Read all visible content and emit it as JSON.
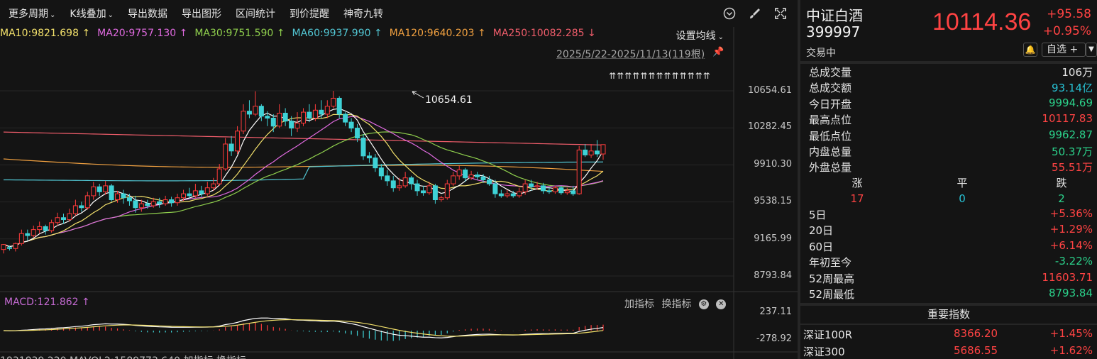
{
  "toolbar": {
    "items": [
      "更多周期",
      "K线叠加",
      "导出数据",
      "导出图形",
      "区间统计",
      "到价提醒",
      "神奇九转"
    ]
  },
  "ma": [
    {
      "label": "MA10:9821.698",
      "arrow": "↑",
      "color": "#f2e06b"
    },
    {
      "label": "MA20:9757.130",
      "arrow": "↑",
      "color": "#e06ae0"
    },
    {
      "label": "MA30:9751.590",
      "arrow": "↑",
      "color": "#8fcf4d"
    },
    {
      "label": "MA60:9937.990",
      "arrow": "↑",
      "color": "#52c7d4"
    },
    {
      "label": "MA120:9640.203",
      "arrow": "↑",
      "color": "#f0a040"
    },
    {
      "label": "MA250:10082.285",
      "arrow": "↓",
      "color": "#f05d6b"
    }
  ],
  "ma_setting": "设置均线",
  "range_label": "2025/5/22-2025/11/13(119根)",
  "marker_arrows": "⇈⇈⇈⇈⇈⇈⇈⇈⇈⇈⇈⇈⇈",
  "peak_label": "10654.61",
  "price_axis": [
    "10654.61",
    "10282.45",
    "9910.30",
    "9538.15",
    "9165.99",
    "8793.84"
  ],
  "macd": {
    "title": "MACD:121.862",
    "arrow": "↑",
    "add_indicator": "加指标",
    "switch_indicator": "换指标",
    "axis": [
      "237.11",
      "-278.92"
    ]
  },
  "bottom_cut": "1831839.220   MAVOL2:1589773.640   加指标 换指标",
  "quote": {
    "name": "中证白酒",
    "code": "399997",
    "status": "交易中",
    "price": "10114.36",
    "change": "+95.58",
    "pct": "+0.95%",
    "watch": "自选 +"
  },
  "stats": [
    {
      "label": "总成交量",
      "value": "106万",
      "color": "white"
    },
    {
      "label": "总成交额",
      "value": "93.14亿",
      "color": "cyan"
    },
    {
      "label": "今日开盘",
      "value": "9994.69",
      "color": "green"
    },
    {
      "label": "最高点位",
      "value": "10117.83",
      "color": "red"
    },
    {
      "label": "最低点位",
      "value": "9962.87",
      "color": "green"
    },
    {
      "label": "内盘总量",
      "value": "50.37万",
      "color": "green"
    },
    {
      "label": "外盘总量",
      "value": "55.51万",
      "color": "red"
    }
  ],
  "updown": {
    "up_label": "涨",
    "flat_label": "平",
    "down_label": "跌",
    "up": "17",
    "flat": "0",
    "down": "2"
  },
  "periods": [
    {
      "label": "5日",
      "value": "+5.36%",
      "color": "red"
    },
    {
      "label": "20日",
      "value": "+1.29%",
      "color": "red"
    },
    {
      "label": "60日",
      "value": "+6.14%",
      "color": "red"
    },
    {
      "label": "年初至今",
      "value": "-3.22%",
      "color": "green"
    },
    {
      "label": "52周最高",
      "value": "11603.71",
      "color": "red"
    },
    {
      "label": "52周最低",
      "value": "8793.84",
      "color": "green"
    }
  ],
  "index_title": "重要指数",
  "indices": [
    {
      "name": "深证100R",
      "price": "8366.20",
      "chg": "+1.45%"
    },
    {
      "name": "深证300",
      "price": "5686.55",
      "chg": "+1.62%"
    }
  ],
  "chart_data": {
    "type": "candlestick",
    "y_range": [
      8793.84,
      10654.61
    ],
    "colors": {
      "up": "#ff3b3b",
      "down": "#3ed2d6"
    },
    "candles": [
      [
        9060,
        9110,
        9020,
        9080
      ],
      [
        9080,
        9070,
        9050,
        9100
      ],
      [
        9070,
        9120,
        9040,
        9130
      ],
      [
        9120,
        9220,
        9100,
        9260
      ],
      [
        9220,
        9200,
        9150,
        9260
      ],
      [
        9200,
        9260,
        9180,
        9300
      ],
      [
        9260,
        9290,
        9220,
        9340
      ],
      [
        9290,
        9250,
        9210,
        9310
      ],
      [
        9250,
        9330,
        9230,
        9360
      ],
      [
        9330,
        9380,
        9300,
        9430
      ],
      [
        9380,
        9360,
        9320,
        9420
      ],
      [
        9360,
        9420,
        9340,
        9470
      ],
      [
        9420,
        9500,
        9400,
        9560
      ],
      [
        9500,
        9480,
        9440,
        9540
      ],
      [
        9480,
        9600,
        9460,
        9640
      ],
      [
        9600,
        9690,
        9560,
        9740
      ],
      [
        9690,
        9640,
        9600,
        9720
      ],
      [
        9640,
        9700,
        9610,
        9750
      ],
      [
        9700,
        9560,
        9540,
        9720
      ],
      [
        9560,
        9620,
        9530,
        9650
      ],
      [
        9620,
        9580,
        9520,
        9660
      ],
      [
        9580,
        9550,
        9500,
        9620
      ],
      [
        9550,
        9480,
        9430,
        9600
      ],
      [
        9480,
        9520,
        9440,
        9560
      ],
      [
        9520,
        9500,
        9470,
        9560
      ],
      [
        9500,
        9540,
        9480,
        9580
      ],
      [
        9540,
        9520,
        9480,
        9580
      ],
      [
        9520,
        9560,
        9500,
        9600
      ],
      [
        9560,
        9530,
        9490,
        9590
      ],
      [
        9530,
        9580,
        9500,
        9620
      ],
      [
        9580,
        9620,
        9550,
        9660
      ],
      [
        9620,
        9600,
        9570,
        9680
      ],
      [
        9600,
        9650,
        9580,
        9720
      ],
      [
        9650,
        9620,
        9590,
        9700
      ],
      [
        9620,
        9680,
        9600,
        9740
      ],
      [
        9680,
        9720,
        9650,
        9780
      ],
      [
        9720,
        9870,
        9700,
        9920
      ],
      [
        9870,
        10120,
        9850,
        10180
      ],
      [
        10120,
        10050,
        10000,
        10200
      ],
      [
        10050,
        10250,
        10020,
        10300
      ],
      [
        10250,
        10450,
        10220,
        10520
      ],
      [
        10450,
        10420,
        10380,
        10560
      ],
      [
        10420,
        10500,
        10400,
        10650
      ],
      [
        10500,
        10400,
        10350,
        10520
      ],
      [
        10400,
        10380,
        10300,
        10450
      ],
      [
        10380,
        10300,
        10240,
        10420
      ],
      [
        10300,
        10430,
        10280,
        10520
      ],
      [
        10430,
        10350,
        10300,
        10480
      ],
      [
        10350,
        10280,
        10200,
        10400
      ],
      [
        10280,
        10330,
        10240,
        10440
      ],
      [
        10330,
        10440,
        10300,
        10480
      ],
      [
        10440,
        10380,
        10340,
        10520
      ],
      [
        10380,
        10460,
        10350,
        10520
      ],
      [
        10460,
        10420,
        10380,
        10560
      ],
      [
        10420,
        10500,
        10380,
        10560
      ],
      [
        10500,
        10580,
        10480,
        10654
      ],
      [
        10580,
        10420,
        10380,
        10600
      ],
      [
        10420,
        10340,
        10300,
        10440
      ],
      [
        10340,
        10280,
        10240,
        10380
      ],
      [
        10280,
        10180,
        10140,
        10320
      ],
      [
        10180,
        10000,
        9960,
        10220
      ],
      [
        10000,
        9980,
        9930,
        10040
      ],
      [
        9980,
        9880,
        9840,
        10020
      ],
      [
        9880,
        9800,
        9760,
        9920
      ],
      [
        9800,
        9750,
        9700,
        9860
      ],
      [
        9750,
        9680,
        9640,
        9800
      ],
      [
        9680,
        9700,
        9650,
        9780
      ],
      [
        9700,
        9780,
        9680,
        9840
      ],
      [
        9780,
        9720,
        9660,
        9800
      ],
      [
        9720,
        9650,
        9600,
        9760
      ],
      [
        9650,
        9630,
        9600,
        9700
      ],
      [
        9630,
        9700,
        9610,
        9740
      ],
      [
        9700,
        9560,
        9520,
        9720
      ],
      [
        9560,
        9580,
        9540,
        9600
      ],
      [
        9580,
        9720,
        9560,
        9760
      ],
      [
        9720,
        9800,
        9700,
        9840
      ],
      [
        9800,
        9860,
        9760,
        9900
      ],
      [
        9860,
        9780,
        9740,
        9880
      ],
      [
        9780,
        9810,
        9760,
        9850
      ],
      [
        9810,
        9790,
        9760,
        9840
      ],
      [
        9790,
        9760,
        9730,
        9820
      ],
      [
        9760,
        9720,
        9700,
        9800
      ],
      [
        9720,
        9620,
        9580,
        9760
      ],
      [
        9620,
        9600,
        9580,
        9660
      ],
      [
        9600,
        9620,
        9580,
        9660
      ],
      [
        9620,
        9600,
        9580,
        9650
      ],
      [
        9600,
        9640,
        9580,
        9680
      ],
      [
        9640,
        9720,
        9610,
        9760
      ],
      [
        9720,
        9690,
        9650,
        9760
      ],
      [
        9690,
        9700,
        9660,
        9740
      ],
      [
        9700,
        9650,
        9620,
        9730
      ],
      [
        9650,
        9640,
        9620,
        9680
      ],
      [
        9640,
        9680,
        9620,
        9700
      ],
      [
        9680,
        9630,
        9610,
        9700
      ],
      [
        9630,
        9650,
        9610,
        9680
      ],
      [
        9650,
        9620,
        9600,
        9700
      ],
      [
        9620,
        10060,
        9610,
        10100
      ],
      [
        10060,
        10010,
        9990,
        10120
      ],
      [
        10010,
        10050,
        9980,
        10120
      ],
      [
        10050,
        10020,
        9990,
        10160
      ],
      [
        10020,
        10114,
        9962,
        10117
      ]
    ]
  }
}
